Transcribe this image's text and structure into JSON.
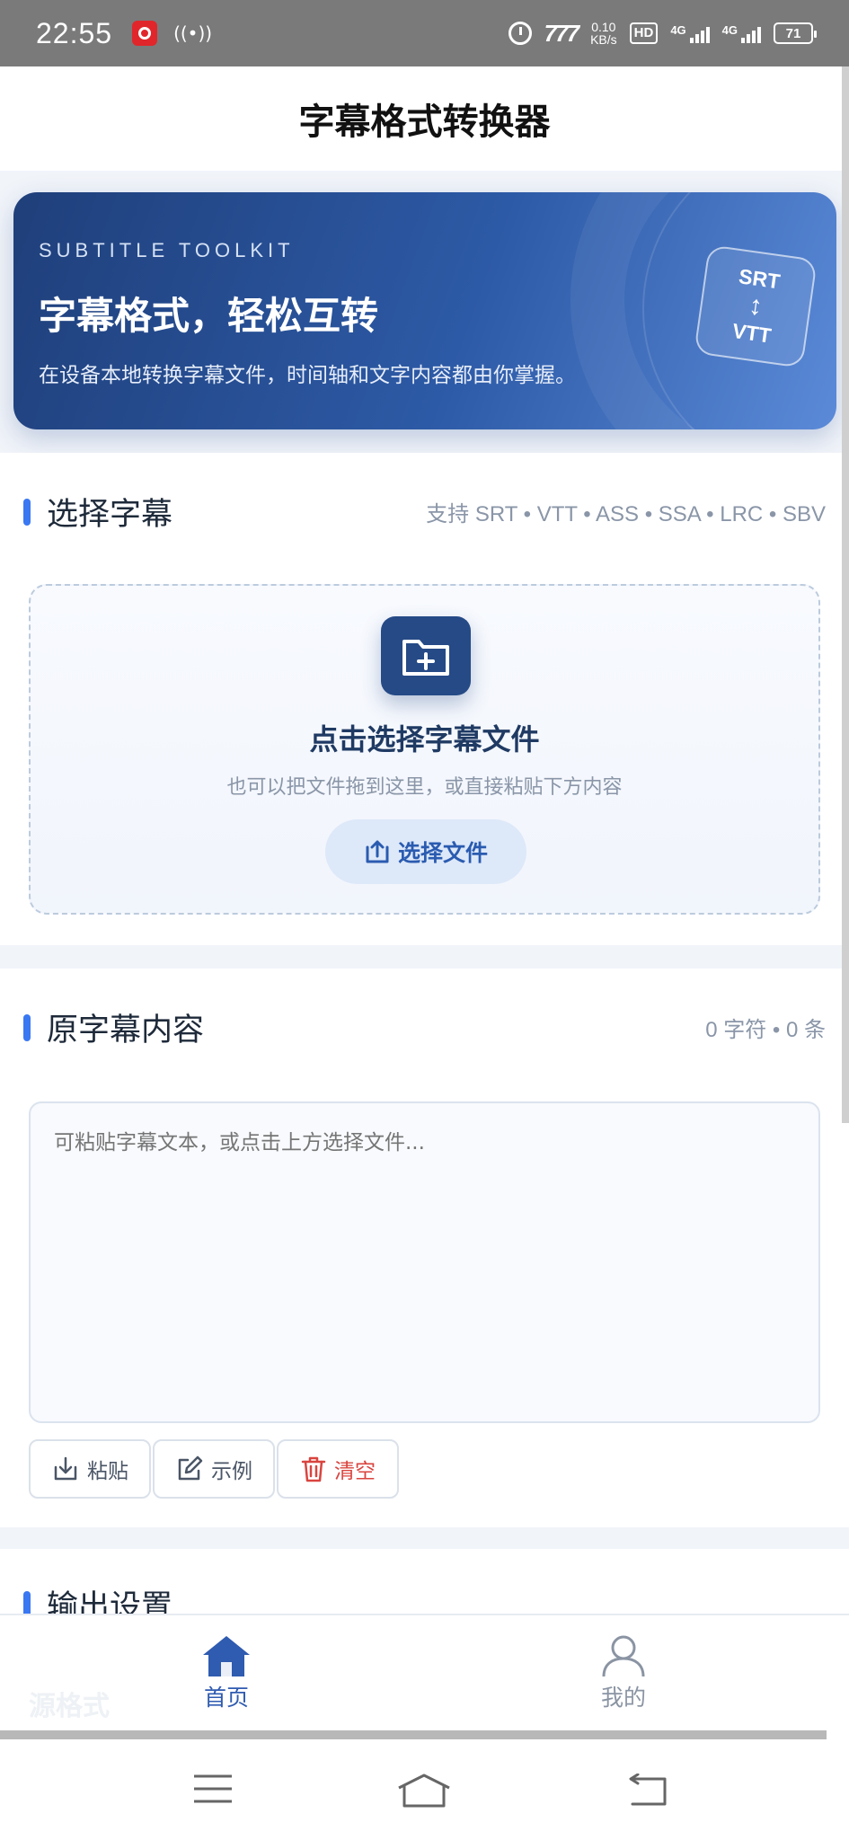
{
  "status_bar": {
    "time": "22:55",
    "speed_value": "0.10",
    "speed_unit": "KB/s",
    "hd": "HD",
    "sim1_label": "4G",
    "sim2_label": "4G",
    "battery": "71"
  },
  "header": {
    "title": "字幕格式转换器"
  },
  "hero": {
    "kicker": "SUBTITLE TOOLKIT",
    "title": "字幕格式，轻松互转",
    "subtitle": "在设备本地转换字幕文件，时间轴和文字内容都由你掌握。",
    "badge_top": "SRT",
    "badge_arrow": "↕",
    "badge_bottom": "VTT"
  },
  "select_section": {
    "title": "选择字幕",
    "supported": "支持 SRT • VTT • ASS • SSA • LRC • SBV",
    "drop_title": "点击选择字幕文件",
    "drop_hint": "也可以把文件拖到这里，或直接粘贴下方内容",
    "choose_button": "选择文件"
  },
  "source_section": {
    "title": "原字幕内容",
    "stats": "0 字符 • 0 条",
    "placeholder": "可粘贴字幕文本，或点击上方选择文件...",
    "paste_button": "粘贴",
    "example_button": "示例",
    "clear_button": "清空"
  },
  "output_section": {
    "title": "输出设置",
    "partial_label": "源格式"
  },
  "bottom_nav": {
    "home": "首页",
    "mine": "我的"
  },
  "colors": {
    "accent": "#3a78f2",
    "primary_dark": "#254a86",
    "danger": "#d9443f"
  }
}
